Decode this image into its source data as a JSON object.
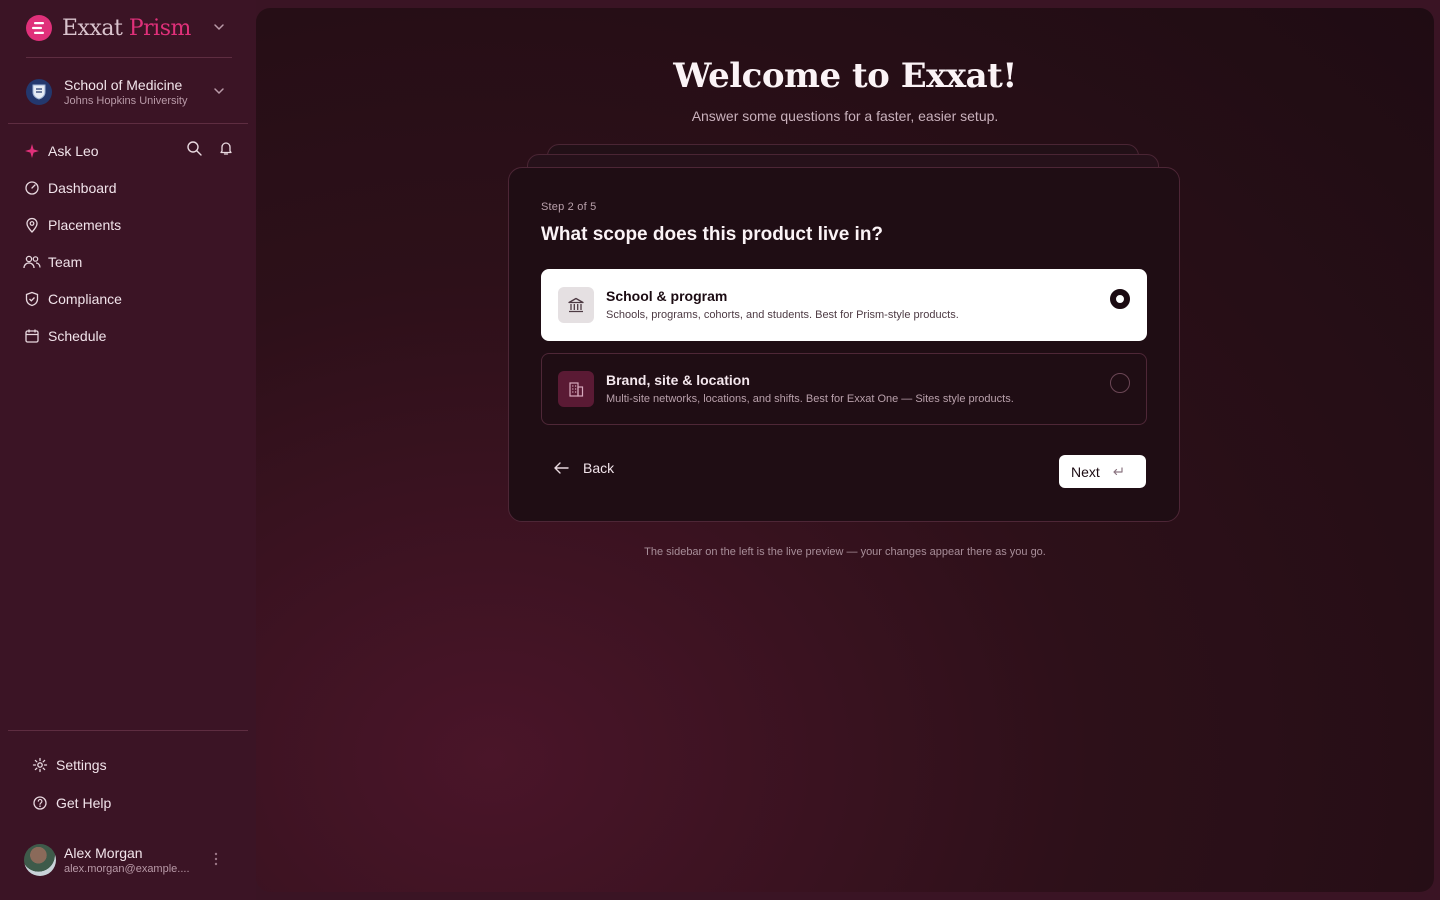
{
  "brand": {
    "name_part1": "Exxat",
    "name_part2": "Prism"
  },
  "school": {
    "name": "School of Medicine",
    "university": "Johns Hopkins University"
  },
  "nav": {
    "ask": "Ask Leo",
    "items": [
      {
        "label": "Dashboard",
        "icon": "dashboard-icon"
      },
      {
        "label": "Placements",
        "icon": "map-pin-icon"
      },
      {
        "label": "Team",
        "icon": "team-icon"
      },
      {
        "label": "Compliance",
        "icon": "shield-icon"
      },
      {
        "label": "Schedule",
        "icon": "calendar-icon"
      }
    ]
  },
  "bottom_nav": {
    "settings": "Settings",
    "help": "Get Help"
  },
  "user": {
    "name": "Alex Morgan",
    "email": "alex.morgan@example...."
  },
  "main": {
    "title": "Welcome to Exxat!",
    "subtitle": "Answer some questions for a faster, easier setup.",
    "step": "Step 2 of 5",
    "question": "What scope does this product live in?",
    "options": [
      {
        "title": "School & program",
        "desc": "Schools, programs, cohorts, and students. Best for Prism-style products.",
        "selected": true
      },
      {
        "title": "Brand, site & location",
        "desc": "Multi-site networks, locations, and shifts. Best for Exxat One — Sites style products.",
        "selected": false
      }
    ],
    "back_label": "Back",
    "next_label": "Next",
    "footnote": "The sidebar on the left is the live preview — your changes appear there as you go."
  },
  "colors": {
    "accent": "#e0307a",
    "sidebar_bg": "#3b1425",
    "card_bg": "#1f0d14"
  }
}
